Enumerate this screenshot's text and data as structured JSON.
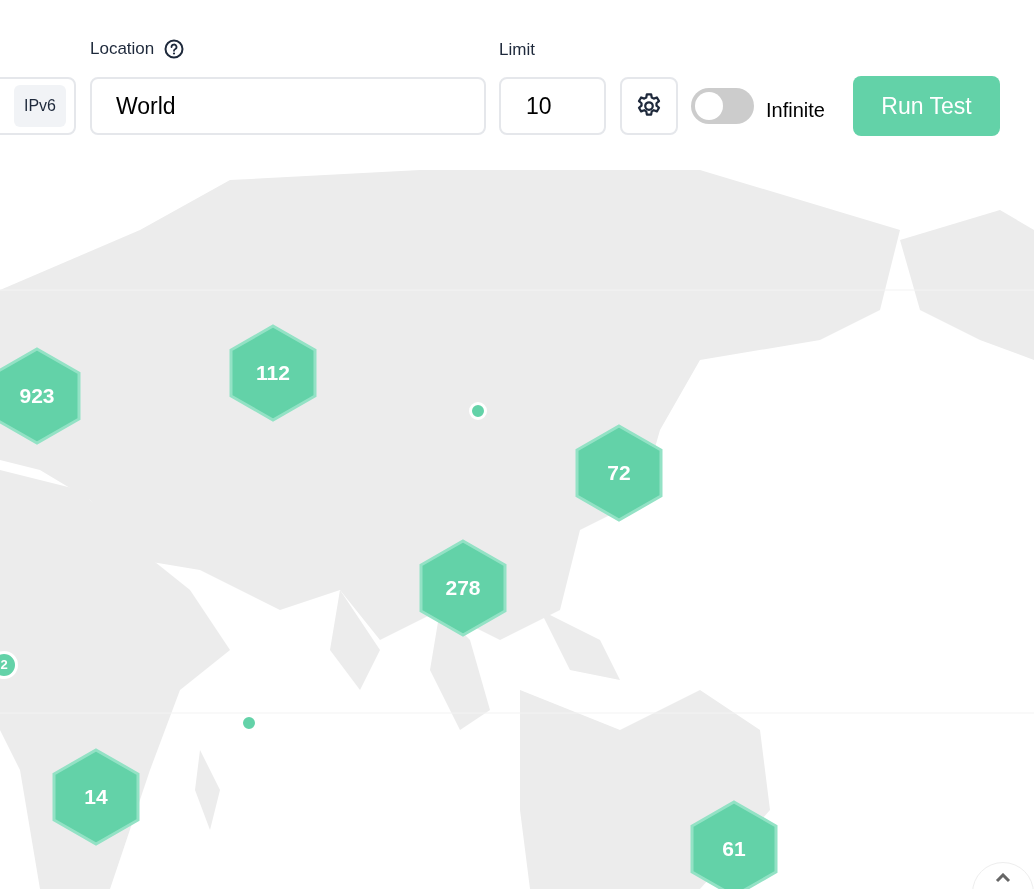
{
  "protocol": {
    "options": [
      {
        "label": "IPv6",
        "selected": true
      }
    ]
  },
  "location": {
    "label": "Location",
    "value": "World"
  },
  "limit": {
    "label": "Limit",
    "value": "10"
  },
  "infinite": {
    "label": "Infinite",
    "on": false
  },
  "run_button": "Run Test",
  "map": {
    "kind": "picture",
    "markers": [
      {
        "kind": "cluster",
        "count": "923"
      },
      {
        "kind": "cluster",
        "count": "112"
      },
      {
        "kind": "dot"
      },
      {
        "kind": "cluster",
        "count": "72"
      },
      {
        "kind": "cluster",
        "count": "278"
      },
      {
        "kind": "circle",
        "count": "2"
      },
      {
        "kind": "dot"
      },
      {
        "kind": "cluster",
        "count": "14"
      },
      {
        "kind": "cluster",
        "count": "61"
      }
    ]
  }
}
